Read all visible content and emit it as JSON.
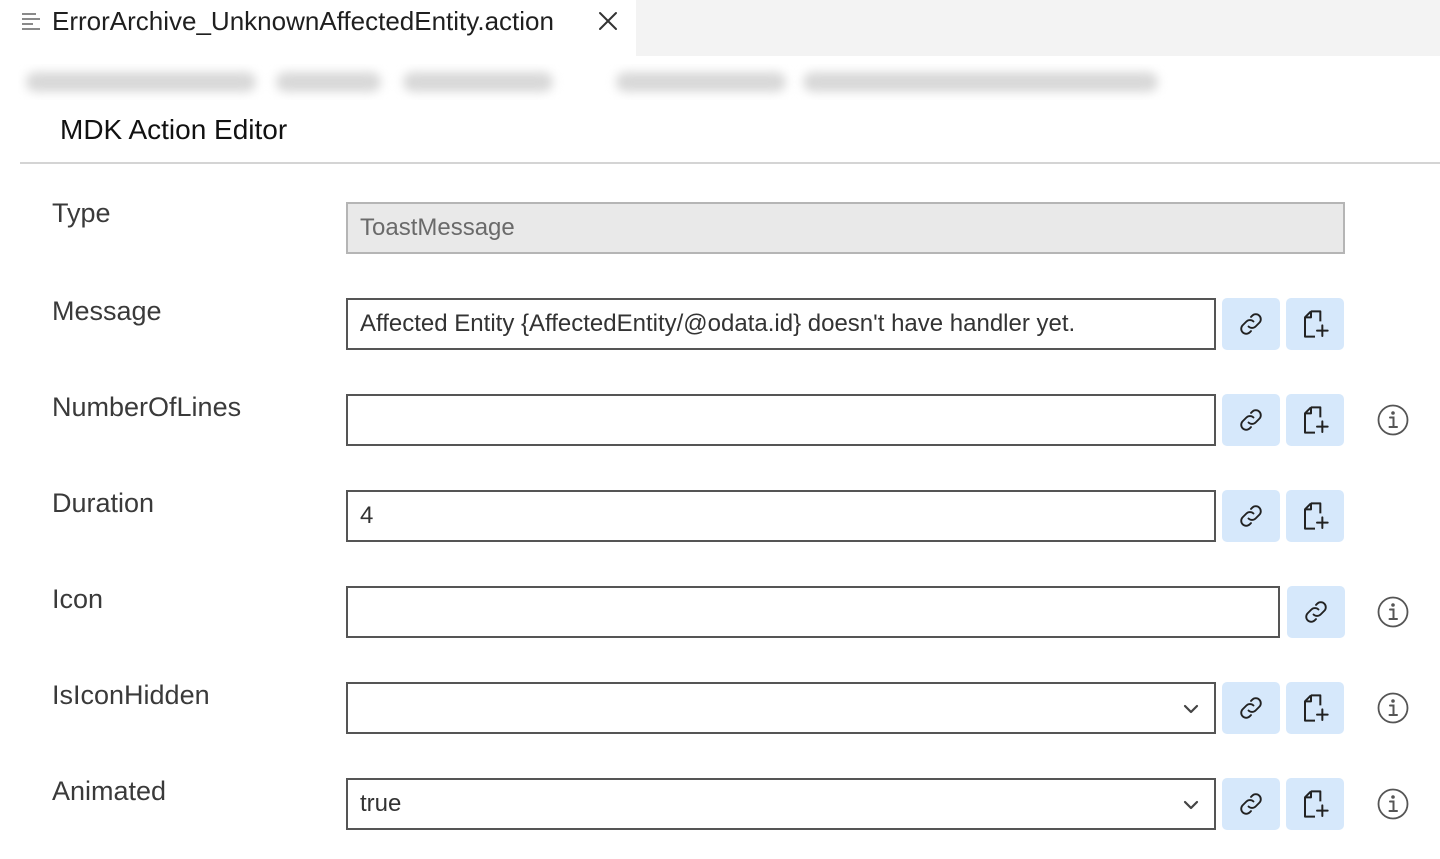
{
  "tab": {
    "title": "ErrorArchive_UnknownAffectedEntity.action",
    "file_icon": "file-lines-icon",
    "close_icon": "close-icon"
  },
  "editor": {
    "title": "MDK Action Editor"
  },
  "colors": {
    "button_bg": "#d6e8fb",
    "readonly_bg": "#e9e9e9",
    "tabbar_bg": "#f3f3f3"
  },
  "fields": {
    "type": {
      "label": "Type",
      "value": "ToastMessage"
    },
    "message": {
      "label": "Message",
      "value": "Affected Entity {AffectedEntity/@odata.id} doesn't have handler yet."
    },
    "number_of_lines": {
      "label": "NumberOfLines",
      "value": ""
    },
    "duration": {
      "label": "Duration",
      "value": "4"
    },
    "icon": {
      "label": "Icon",
      "value": ""
    },
    "is_icon_hidden": {
      "label": "IsIconHidden",
      "value": ""
    },
    "animated": {
      "label": "Animated",
      "value": "true"
    }
  },
  "icons": {
    "bind": "link-icon",
    "create": "new-file-icon",
    "info": "info-icon",
    "dropdown": "chevron-down-icon"
  }
}
